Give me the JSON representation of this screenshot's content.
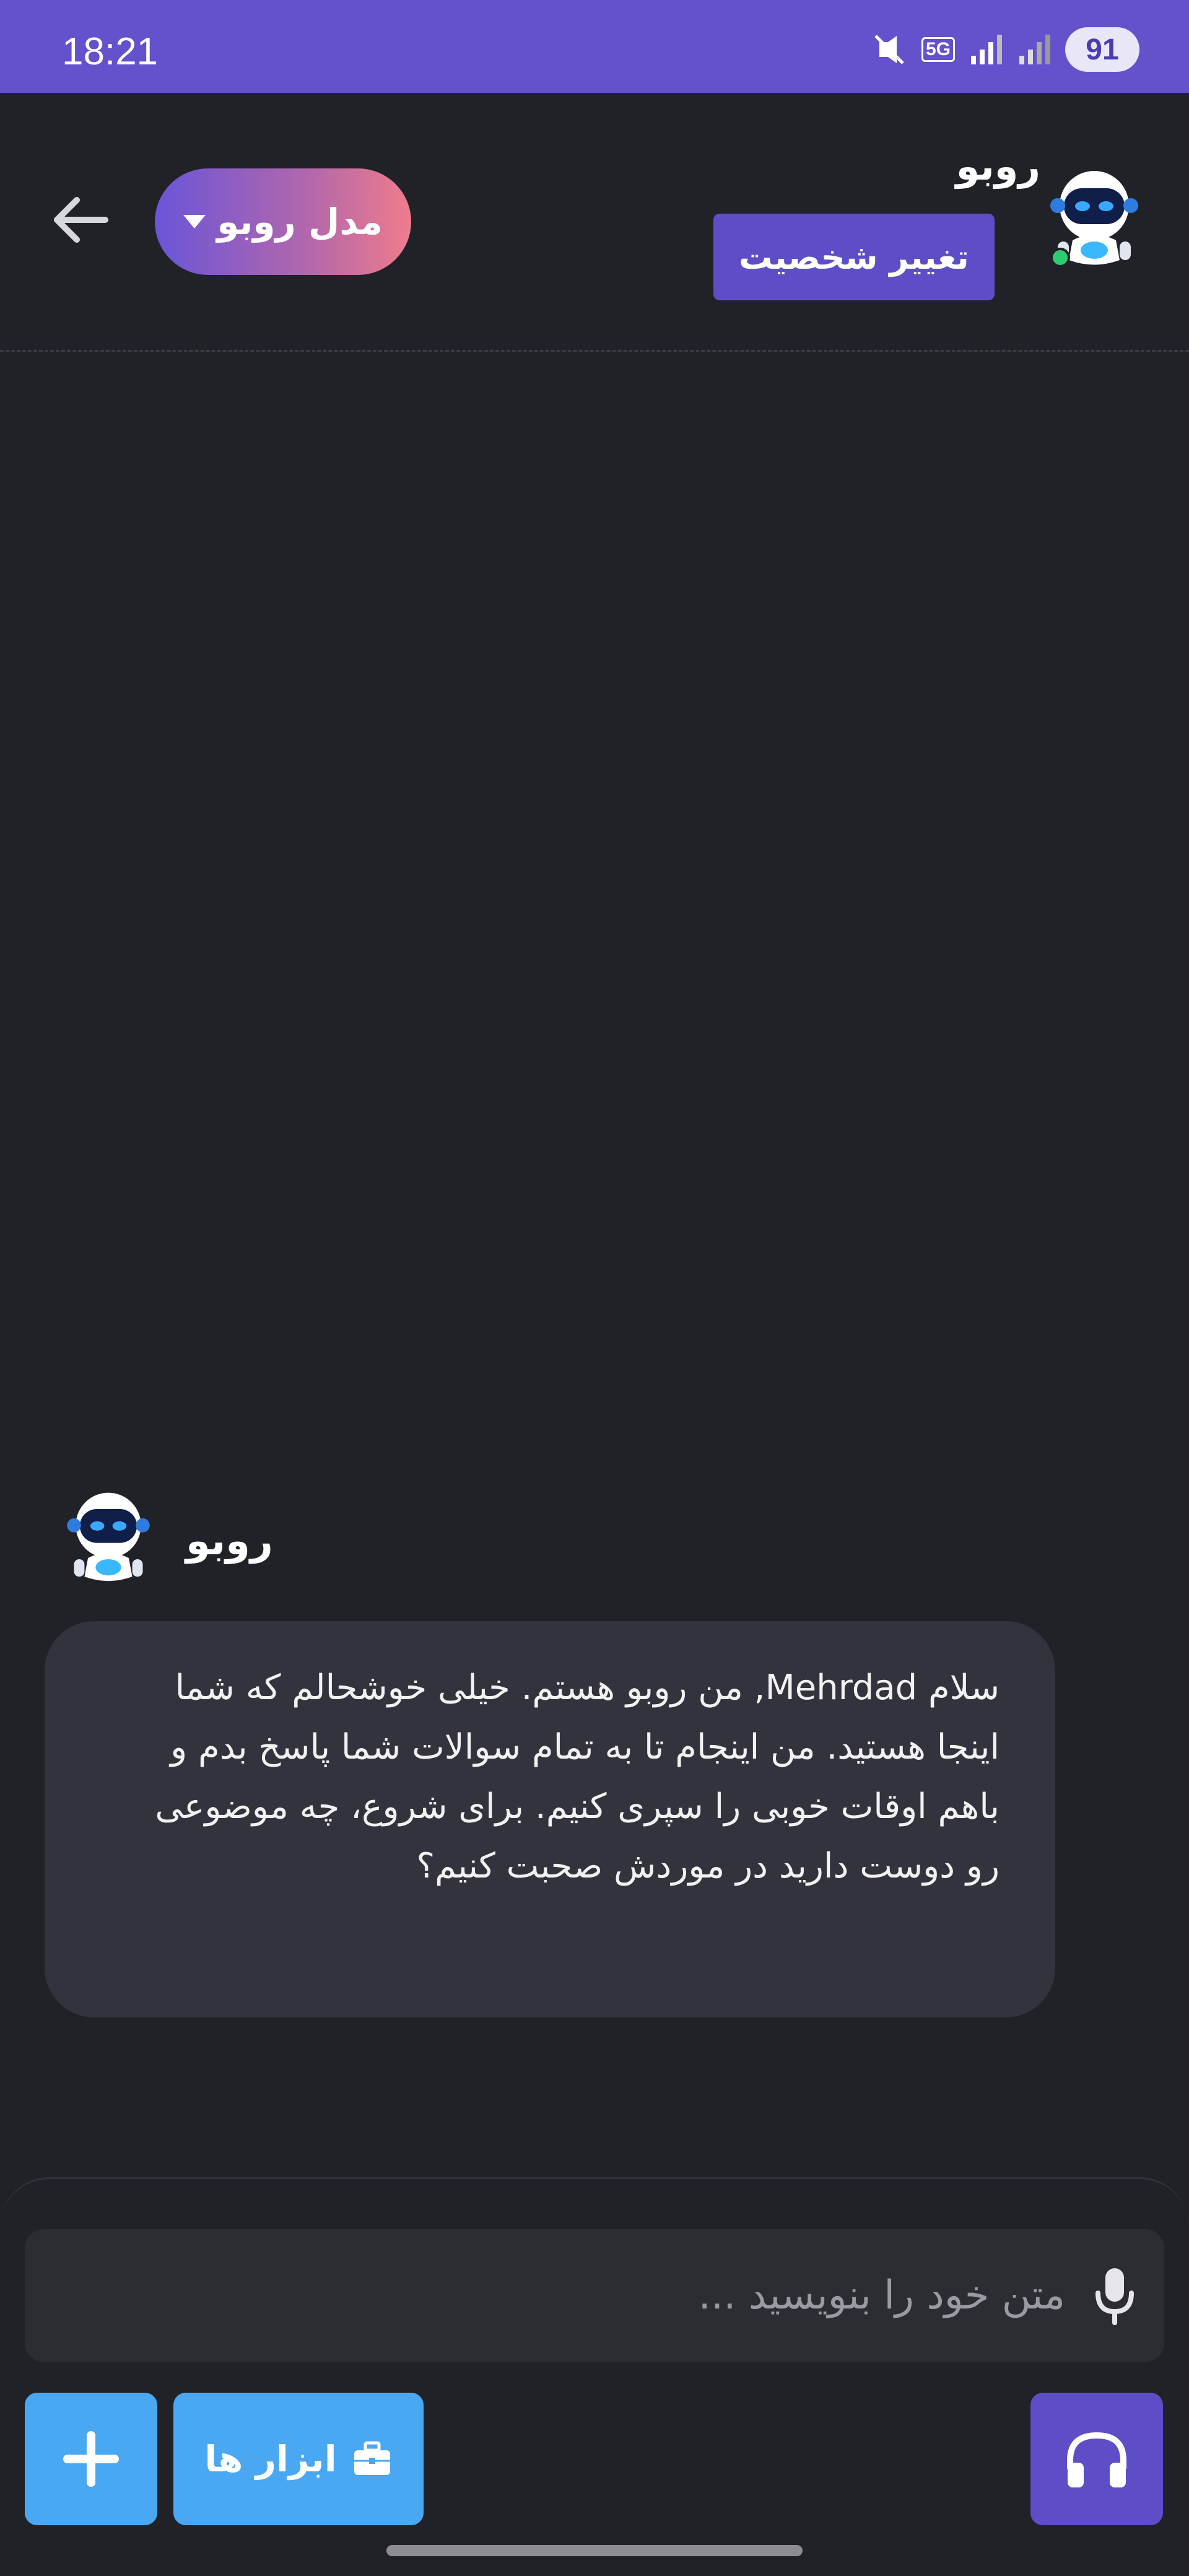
{
  "status_bar": {
    "time": "18:21",
    "network": "5G",
    "battery": "91",
    "icons": [
      "mute-vibrate-icon",
      "5g-data-icon",
      "signal-icon",
      "signal-icon"
    ]
  },
  "header": {
    "bot_name": "روبو",
    "change_persona_label": "تغییر شخصیت",
    "model_selector_label": "مدل روبو",
    "status": "online"
  },
  "chat": {
    "messages": [
      {
        "sender": "روبو",
        "text": "سلام Mehrdad, من روبو هستم. خیلی خوشحالم که شما اینجا هستید. من اینجام تا به تمام سوالات شما پاسخ بدم و باهم اوقات خوبی را سپری کنیم. برای شروع، چه موضوعی رو دوست دارید در موردش صحبت کنیم؟"
      }
    ]
  },
  "composer": {
    "placeholder": "متن خود را بنویسید ...",
    "value": "",
    "tools_label": "ابزار ها"
  },
  "colors": {
    "background": "#202227",
    "status_bar": "#6451cc",
    "accent_purple": "#5d4ec7",
    "accent_blue": "#4aa8f2",
    "bubble": "#32333d",
    "online": "#2ecc71"
  }
}
